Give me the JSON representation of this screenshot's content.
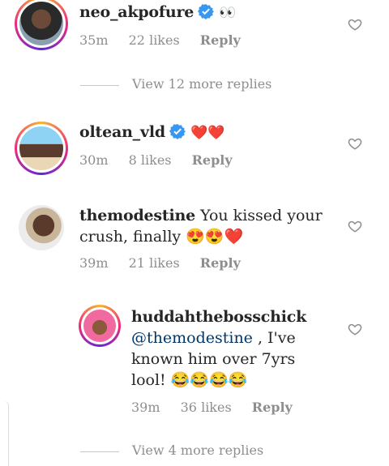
{
  "comments": [
    {
      "username": "neo_akpofure",
      "text": "👀",
      "time": "35m",
      "likes": "22 likes",
      "reply": "Reply",
      "view_more": "View 12 more replies"
    },
    {
      "username": "oltean_vld",
      "text": "❤️❤️",
      "time": "30m",
      "likes": "8 likes",
      "reply": "Reply"
    },
    {
      "username": "themodestine",
      "text_line1": "You kissed your",
      "text_line2": "crush, finally 😍😍❤️",
      "time": "39m",
      "likes": "21 likes",
      "reply": "Reply"
    },
    {
      "username": "huddahthebosschick",
      "mention": "@themodestine",
      "text_line1": " , I've",
      "text_line2": "known him over 7yrs",
      "text_line3": "lool! 😂😂😂😂",
      "time": "39m",
      "likes": "36 likes",
      "reply": "Reply",
      "view_more": "View 4 more replies"
    }
  ],
  "icons": {
    "verified": "verified-badge-icon",
    "like": "heart-outline-icon"
  },
  "colors": {
    "verified_blue": "#3897f0",
    "muted_text": "#8e8e8e",
    "mention": "#00376b"
  }
}
